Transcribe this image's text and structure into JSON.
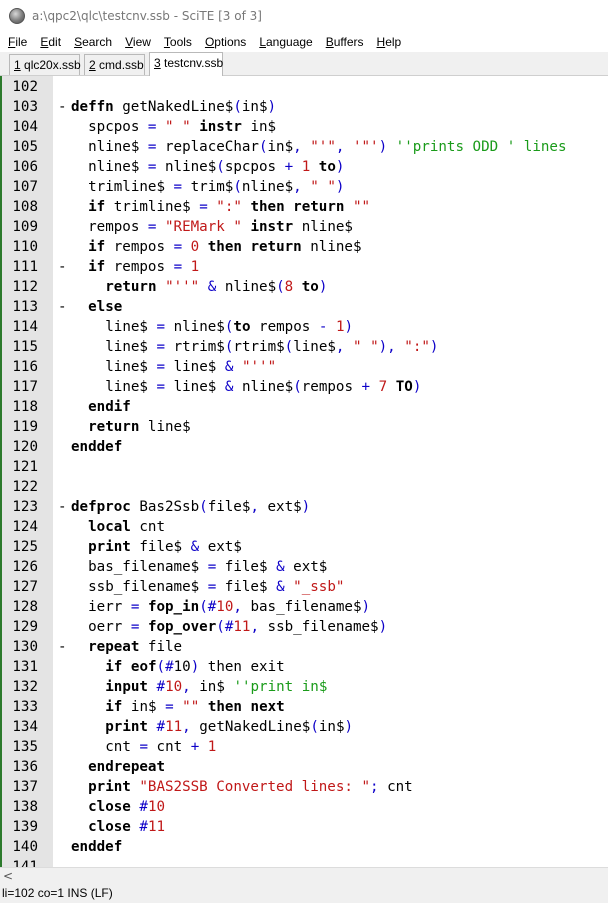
{
  "window": {
    "title": "a:\\qpc2\\qlc\\testcnv.ssb - SciTE [3 of 3]"
  },
  "menu": [
    {
      "label": "File",
      "acc": "F",
      "rest": "ile"
    },
    {
      "label": "Edit",
      "acc": "E",
      "rest": "dit"
    },
    {
      "label": "Search",
      "acc": "S",
      "rest": "earch"
    },
    {
      "label": "View",
      "acc": "V",
      "rest": "iew"
    },
    {
      "label": "Tools",
      "acc": "T",
      "rest": "ools"
    },
    {
      "label": "Options",
      "acc": "O",
      "rest": "ptions"
    },
    {
      "label": "Language",
      "acc": "L",
      "rest": "anguage"
    },
    {
      "label": "Buffers",
      "acc": "B",
      "rest": "uffers"
    },
    {
      "label": "Help",
      "acc": "H",
      "rest": "elp"
    }
  ],
  "tabs": [
    {
      "num": "1",
      "name": "qlc20x.ssb",
      "active": false
    },
    {
      "num": "2",
      "name": "cmd.ssb",
      "active": false
    },
    {
      "num": "3",
      "name": "testcnv.ssb",
      "active": true
    }
  ],
  "editor": {
    "lines": [
      {
        "n": "102",
        "fold": "",
        "indent": 0,
        "tokens": []
      },
      {
        "n": "103",
        "fold": "-",
        "indent": 0,
        "tokens": [
          [
            "kw",
            "deffn"
          ],
          [
            "id",
            " getNakedLine$"
          ],
          [
            "op",
            "("
          ],
          [
            "id",
            "in$"
          ],
          [
            "op",
            ")"
          ]
        ]
      },
      {
        "n": "104",
        "fold": "",
        "indent": 2,
        "tokens": [
          [
            "id",
            "spcpos "
          ],
          [
            "op",
            "="
          ],
          [
            "id",
            " "
          ],
          [
            "str",
            "\" \""
          ],
          [
            "id",
            " "
          ],
          [
            "kw",
            "instr"
          ],
          [
            "id",
            " in$"
          ]
        ]
      },
      {
        "n": "105",
        "fold": "",
        "indent": 2,
        "tokens": [
          [
            "id",
            "nline$ "
          ],
          [
            "op",
            "="
          ],
          [
            "id",
            " replaceChar"
          ],
          [
            "op",
            "("
          ],
          [
            "id",
            "in$"
          ],
          [
            "op",
            ","
          ],
          [
            "id",
            " "
          ],
          [
            "str",
            "\"'\""
          ],
          [
            "op",
            ","
          ],
          [
            "id",
            " "
          ],
          [
            "str",
            "'\"'"
          ],
          [
            "op",
            ")"
          ],
          [
            "id",
            " "
          ],
          [
            "cmt",
            "''prints ODD ' lines"
          ]
        ]
      },
      {
        "n": "106",
        "fold": "",
        "indent": 2,
        "tokens": [
          [
            "id",
            "nline$ "
          ],
          [
            "op",
            "="
          ],
          [
            "id",
            " nline$"
          ],
          [
            "op",
            "("
          ],
          [
            "id",
            "spcpos "
          ],
          [
            "op",
            "+"
          ],
          [
            "id",
            " "
          ],
          [
            "num",
            "1"
          ],
          [
            "id",
            " "
          ],
          [
            "kw",
            "to"
          ],
          [
            "op",
            ")"
          ]
        ]
      },
      {
        "n": "107",
        "fold": "",
        "indent": 2,
        "tokens": [
          [
            "id",
            "trimline$ "
          ],
          [
            "op",
            "="
          ],
          [
            "id",
            " trim$"
          ],
          [
            "op",
            "("
          ],
          [
            "id",
            "nline$"
          ],
          [
            "op",
            ","
          ],
          [
            "id",
            " "
          ],
          [
            "str",
            "\" \""
          ],
          [
            "op",
            ")"
          ]
        ]
      },
      {
        "n": "108",
        "fold": "",
        "indent": 2,
        "tokens": [
          [
            "kw",
            "if"
          ],
          [
            "id",
            " trimline$ "
          ],
          [
            "op",
            "="
          ],
          [
            "id",
            " "
          ],
          [
            "str",
            "\":\""
          ],
          [
            "id",
            " "
          ],
          [
            "kw",
            "then"
          ],
          [
            "id",
            " "
          ],
          [
            "kw",
            "return"
          ],
          [
            "id",
            " "
          ],
          [
            "str",
            "\"\""
          ]
        ]
      },
      {
        "n": "109",
        "fold": "",
        "indent": 2,
        "tokens": [
          [
            "id",
            "rempos "
          ],
          [
            "op",
            "="
          ],
          [
            "id",
            " "
          ],
          [
            "str",
            "\"REMark \""
          ],
          [
            "id",
            " "
          ],
          [
            "kw",
            "instr"
          ],
          [
            "id",
            " nline$"
          ]
        ]
      },
      {
        "n": "110",
        "fold": "",
        "indent": 2,
        "tokens": [
          [
            "kw",
            "if"
          ],
          [
            "id",
            " rempos "
          ],
          [
            "op",
            "="
          ],
          [
            "id",
            " "
          ],
          [
            "num",
            "0"
          ],
          [
            "id",
            " "
          ],
          [
            "kw",
            "then"
          ],
          [
            "id",
            " "
          ],
          [
            "kw",
            "return"
          ],
          [
            "id",
            " nline$"
          ]
        ]
      },
      {
        "n": "111",
        "fold": "-",
        "indent": 2,
        "tokens": [
          [
            "kw",
            "if"
          ],
          [
            "id",
            " rempos "
          ],
          [
            "op",
            "="
          ],
          [
            "id",
            " "
          ],
          [
            "num",
            "1"
          ]
        ]
      },
      {
        "n": "112",
        "fold": "",
        "indent": 4,
        "tokens": [
          [
            "kw",
            "return"
          ],
          [
            "id",
            " "
          ],
          [
            "str",
            "\"''\""
          ],
          [
            "id",
            " "
          ],
          [
            "op",
            "&"
          ],
          [
            "id",
            " nline$"
          ],
          [
            "op",
            "("
          ],
          [
            "num",
            "8"
          ],
          [
            "id",
            " "
          ],
          [
            "kw",
            "to"
          ],
          [
            "op",
            ")"
          ]
        ]
      },
      {
        "n": "113",
        "fold": "-",
        "indent": 2,
        "tokens": [
          [
            "kw",
            "else"
          ]
        ]
      },
      {
        "n": "114",
        "fold": "",
        "indent": 4,
        "tokens": [
          [
            "id",
            "line$ "
          ],
          [
            "op",
            "="
          ],
          [
            "id",
            " nline$"
          ],
          [
            "op",
            "("
          ],
          [
            "kw",
            "to"
          ],
          [
            "id",
            " rempos "
          ],
          [
            "op",
            "-"
          ],
          [
            "id",
            " "
          ],
          [
            "num",
            "1"
          ],
          [
            "op",
            ")"
          ]
        ]
      },
      {
        "n": "115",
        "fold": "",
        "indent": 4,
        "tokens": [
          [
            "id",
            "line$ "
          ],
          [
            "op",
            "="
          ],
          [
            "id",
            " rtrim$"
          ],
          [
            "op",
            "("
          ],
          [
            "id",
            "rtrim$"
          ],
          [
            "op",
            "("
          ],
          [
            "id",
            "line$"
          ],
          [
            "op",
            ","
          ],
          [
            "id",
            " "
          ],
          [
            "str",
            "\" \""
          ],
          [
            "op",
            "),"
          ],
          [
            "id",
            " "
          ],
          [
            "str",
            "\":\""
          ],
          [
            "op",
            ")"
          ]
        ]
      },
      {
        "n": "116",
        "fold": "",
        "indent": 4,
        "tokens": [
          [
            "id",
            "line$ "
          ],
          [
            "op",
            "="
          ],
          [
            "id",
            " line$ "
          ],
          [
            "op",
            "&"
          ],
          [
            "id",
            " "
          ],
          [
            "str",
            "\"''\""
          ]
        ]
      },
      {
        "n": "117",
        "fold": "",
        "indent": 4,
        "tokens": [
          [
            "id",
            "line$ "
          ],
          [
            "op",
            "="
          ],
          [
            "id",
            " line$ "
          ],
          [
            "op",
            "&"
          ],
          [
            "id",
            " nline$"
          ],
          [
            "op",
            "("
          ],
          [
            "id",
            "rempos "
          ],
          [
            "op",
            "+"
          ],
          [
            "id",
            " "
          ],
          [
            "num",
            "7"
          ],
          [
            "id",
            " "
          ],
          [
            "kw",
            "TO"
          ],
          [
            "op",
            ")"
          ]
        ]
      },
      {
        "n": "118",
        "fold": "",
        "indent": 2,
        "tokens": [
          [
            "kw",
            "endif"
          ]
        ]
      },
      {
        "n": "119",
        "fold": "",
        "indent": 2,
        "tokens": [
          [
            "kw",
            "return"
          ],
          [
            "id",
            " line$"
          ]
        ]
      },
      {
        "n": "120",
        "fold": "",
        "indent": 0,
        "tokens": [
          [
            "kw",
            "enddef"
          ]
        ]
      },
      {
        "n": "121",
        "fold": "",
        "indent": 0,
        "tokens": []
      },
      {
        "n": "122",
        "fold": "",
        "indent": 0,
        "tokens": []
      },
      {
        "n": "123",
        "fold": "-",
        "indent": 0,
        "tokens": [
          [
            "kw",
            "defproc"
          ],
          [
            "id",
            " Bas2Ssb"
          ],
          [
            "op",
            "("
          ],
          [
            "id",
            "file$"
          ],
          [
            "op",
            ","
          ],
          [
            "id",
            " ext$"
          ],
          [
            "op",
            ")"
          ]
        ]
      },
      {
        "n": "124",
        "fold": "",
        "indent": 2,
        "tokens": [
          [
            "kw",
            "local"
          ],
          [
            "id",
            " cnt"
          ]
        ]
      },
      {
        "n": "125",
        "fold": "",
        "indent": 2,
        "tokens": [
          [
            "kw",
            "print"
          ],
          [
            "id",
            " file$ "
          ],
          [
            "op",
            "&"
          ],
          [
            "id",
            " ext$"
          ]
        ]
      },
      {
        "n": "126",
        "fold": "",
        "indent": 2,
        "tokens": [
          [
            "id",
            "bas_filename$ "
          ],
          [
            "op",
            "="
          ],
          [
            "id",
            " file$ "
          ],
          [
            "op",
            "&"
          ],
          [
            "id",
            " ext$"
          ]
        ]
      },
      {
        "n": "127",
        "fold": "",
        "indent": 2,
        "tokens": [
          [
            "id",
            "ssb_filename$ "
          ],
          [
            "op",
            "="
          ],
          [
            "id",
            " file$ "
          ],
          [
            "op",
            "&"
          ],
          [
            "id",
            " "
          ],
          [
            "str",
            "\"_ssb\""
          ]
        ]
      },
      {
        "n": "128",
        "fold": "",
        "indent": 2,
        "tokens": [
          [
            "id",
            "ierr "
          ],
          [
            "op",
            "="
          ],
          [
            "id",
            " "
          ],
          [
            "kw",
            "fop_in"
          ],
          [
            "op",
            "(#"
          ],
          [
            "num",
            "10"
          ],
          [
            "op",
            ","
          ],
          [
            "id",
            " bas_filename$"
          ],
          [
            "op",
            ")"
          ]
        ]
      },
      {
        "n": "129",
        "fold": "",
        "indent": 2,
        "tokens": [
          [
            "id",
            "oerr "
          ],
          [
            "op",
            "="
          ],
          [
            "id",
            " "
          ],
          [
            "kw",
            "fop_over"
          ],
          [
            "op",
            "(#"
          ],
          [
            "num",
            "11"
          ],
          [
            "op",
            ","
          ],
          [
            "id",
            " ssb_filename$"
          ],
          [
            "op",
            ")"
          ]
        ]
      },
      {
        "n": "130",
        "fold": "-",
        "indent": 2,
        "tokens": [
          [
            "kw",
            "repeat"
          ],
          [
            "id",
            " file"
          ]
        ]
      },
      {
        "n": "131",
        "fold": "",
        "indent": 4,
        "tokens": [
          [
            "kw",
            "if"
          ],
          [
            "id",
            " "
          ],
          [
            "kw",
            "eof"
          ],
          [
            "op",
            "(#"
          ],
          [
            "id",
            "10"
          ],
          [
            "op",
            ")"
          ],
          [
            "id",
            " then exit"
          ]
        ]
      },
      {
        "n": "132",
        "fold": "",
        "indent": 4,
        "tokens": [
          [
            "kw",
            "input"
          ],
          [
            "id",
            " "
          ],
          [
            "op",
            "#"
          ],
          [
            "num",
            "10"
          ],
          [
            "op",
            ","
          ],
          [
            "id",
            " in$ "
          ],
          [
            "cmt",
            "''print in$"
          ]
        ]
      },
      {
        "n": "133",
        "fold": "",
        "indent": 4,
        "tokens": [
          [
            "kw",
            "if"
          ],
          [
            "id",
            " in$ "
          ],
          [
            "op",
            "="
          ],
          [
            "id",
            " "
          ],
          [
            "str",
            "\"\""
          ],
          [
            "id",
            " "
          ],
          [
            "kw",
            "then"
          ],
          [
            "id",
            " "
          ],
          [
            "kw",
            "next"
          ]
        ]
      },
      {
        "n": "134",
        "fold": "",
        "indent": 4,
        "tokens": [
          [
            "kw",
            "print"
          ],
          [
            "id",
            " "
          ],
          [
            "op",
            "#"
          ],
          [
            "num",
            "11"
          ],
          [
            "op",
            ","
          ],
          [
            "id",
            " getNakedLine$"
          ],
          [
            "op",
            "("
          ],
          [
            "id",
            "in$"
          ],
          [
            "op",
            ")"
          ]
        ]
      },
      {
        "n": "135",
        "fold": "",
        "indent": 4,
        "tokens": [
          [
            "id",
            "cnt "
          ],
          [
            "op",
            "="
          ],
          [
            "id",
            " cnt "
          ],
          [
            "op",
            "+"
          ],
          [
            "id",
            " "
          ],
          [
            "num",
            "1"
          ]
        ]
      },
      {
        "n": "136",
        "fold": "",
        "indent": 2,
        "tokens": [
          [
            "kw",
            "endrepeat"
          ]
        ]
      },
      {
        "n": "137",
        "fold": "",
        "indent": 2,
        "tokens": [
          [
            "kw",
            "print"
          ],
          [
            "id",
            " "
          ],
          [
            "str",
            "\"BAS2SSB Converted lines: \""
          ],
          [
            "op",
            ";"
          ],
          [
            "id",
            " cnt"
          ]
        ]
      },
      {
        "n": "138",
        "fold": "",
        "indent": 2,
        "tokens": [
          [
            "kw",
            "close"
          ],
          [
            "id",
            " "
          ],
          [
            "op",
            "#"
          ],
          [
            "num",
            "10"
          ]
        ]
      },
      {
        "n": "139",
        "fold": "",
        "indent": 2,
        "tokens": [
          [
            "kw",
            "close"
          ],
          [
            "id",
            " "
          ],
          [
            "op",
            "#"
          ],
          [
            "num",
            "11"
          ]
        ]
      },
      {
        "n": "140",
        "fold": "",
        "indent": 0,
        "tokens": [
          [
            "kw",
            "enddef"
          ]
        ]
      },
      {
        "n": "141",
        "fold": "",
        "indent": 0,
        "tokens": []
      }
    ]
  },
  "scrollbar": {
    "left_arrow": "<"
  },
  "status": {
    "text": "li=102 co=1 INS (LF)"
  }
}
